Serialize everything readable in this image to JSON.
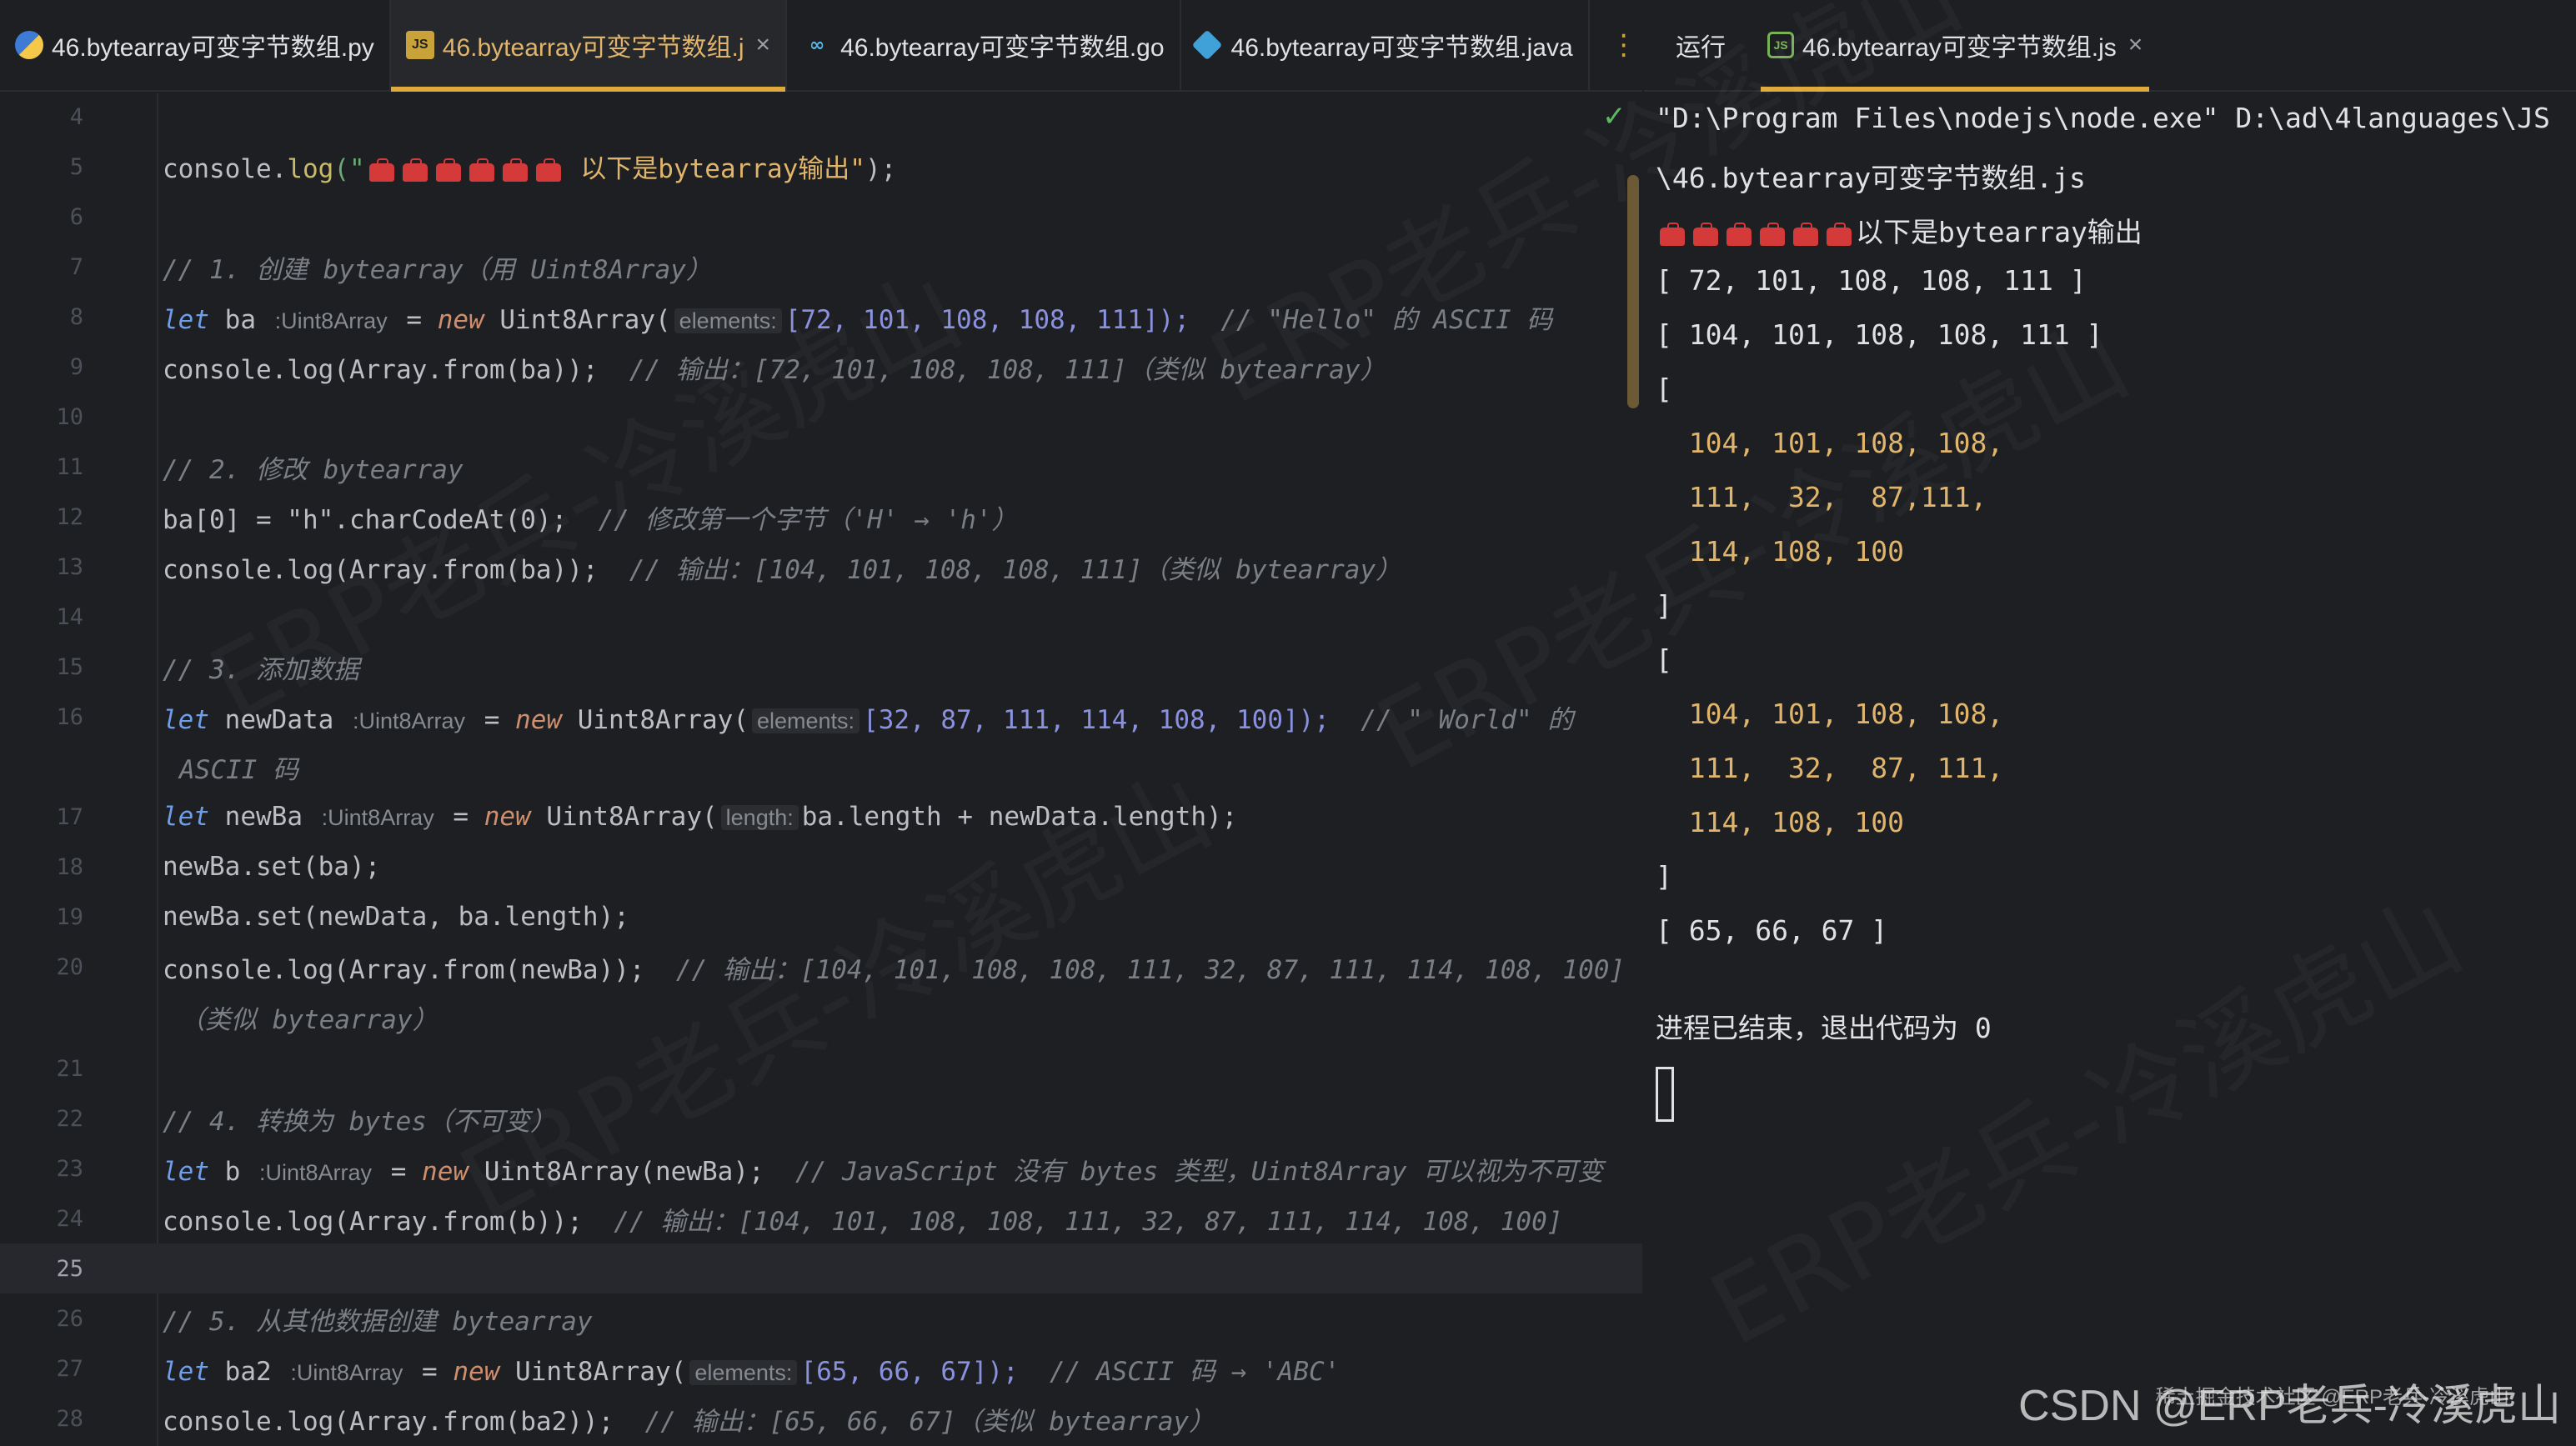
{
  "editor_tabs": [
    {
      "icon": "python-icon",
      "label": "46.bytearray可变字节数组.py",
      "active": false
    },
    {
      "icon": "javascript-icon",
      "label": "46.bytearray可变字节数组.j",
      "active": true,
      "close": "×"
    },
    {
      "icon": "go-icon",
      "label": "46.bytearray可变字节数组.go",
      "active": false
    },
    {
      "icon": "java-icon",
      "label": "46.bytearray可变字节数组.java",
      "active": false
    }
  ],
  "more_tabs": "⋮",
  "run_panel": {
    "label": "运行",
    "tab_label": "46.bytearray可变字节数组.js",
    "close": "×"
  },
  "line_numbers": [
    "4",
    "5",
    "6",
    "7",
    "8",
    "9",
    "10",
    "11",
    "12",
    "13",
    "14",
    "15",
    "16",
    "",
    "17",
    "18",
    "19",
    "20",
    "",
    "21",
    "22",
    "23",
    "24",
    "25",
    "26",
    "27",
    "28"
  ],
  "code": {
    "l5_pre": "console.",
    "l5_log": "log",
    "l5_str_open": "(\"",
    "l5_str_text": " 以下是bytearray输出\"",
    "l5_end": ");",
    "l7": "// 1. 创建 bytearray（用 Uint8Array）",
    "l8_let": "let",
    "l8_var": " ba ",
    "l8_type": ":Uint8Array",
    "l8_eq": " = ",
    "l8_new": "new",
    "l8_cls": " Uint8Array(",
    "l8_hint": "elements:",
    "l8_args": "[72, 101, 108, 108, 111]);",
    "l8_cmt": "  // \"Hello\" 的 ASCII 码",
    "l9_code": "console.log(Array.from(ba));",
    "l9_cmt": "  // 输出：[72, 101, 108, 108, 111]（类似 bytearray）",
    "l11": "// 2. 修改 bytearray",
    "l12_code": "ba[0] = \"h\".charCodeAt(0);",
    "l12_cmt": "  // 修改第一个字节（'H' → 'h'）",
    "l13_code": "console.log(Array.from(ba));",
    "l13_cmt": "  // 输出：[104, 101, 108, 108, 111]（类似 bytearray）",
    "l15": "// 3. 添加数据",
    "l16_let": "let",
    "l16_var": " newData ",
    "l16_type": ":Uint8Array",
    "l16_eq": " = ",
    "l16_new": "new",
    "l16_cls": " Uint8Array(",
    "l16_hint": "elements:",
    "l16_args": "[32, 87, 111, 114, 108, 100]);",
    "l16_cmt": "  // \" World\" 的",
    "l16_cont": "ASCII 码",
    "l17_let": "let",
    "l17_var": " newBa ",
    "l17_type": ":Uint8Array",
    "l17_eq": " = ",
    "l17_new": "new",
    "l17_cls": " Uint8Array(",
    "l17_hint": "length:",
    "l17_args": "ba.length + newData.length);",
    "l18": "newBa.set(ba);",
    "l19": "newBa.set(newData, ba.length);",
    "l20_code": "console.log(Array.from(newBa));",
    "l20_cmt": "  // 输出：[104, 101, 108, 108, 111, 32, 87, 111, 114, 108, 100]",
    "l20_cont": "（类似 bytearray）",
    "l22": "// 4. 转换为 bytes（不可变）",
    "l23_let": "let",
    "l23_var": " b ",
    "l23_type": ":Uint8Array",
    "l23_eq": " = ",
    "l23_new": "new",
    "l23_args": " Uint8Array(newBa);",
    "l23_cmt": "  // JavaScript 没有 bytes 类型，Uint8Array 可以视为不可变",
    "l24_code": "console.log(Array.from(b));",
    "l24_cmt": "  // 输出：[104, 101, 108, 108, 111, 32, 87, 111, 114, 108, 100]",
    "l26": "// 5. 从其他数据创建 bytearray",
    "l27_let": "let",
    "l27_var": " ba2 ",
    "l27_type": ":Uint8Array",
    "l27_eq": " = ",
    "l27_new": "new",
    "l27_cls": " Uint8Array(",
    "l27_hint": "elements:",
    "l27_args": "[65, 66, 67]);",
    "l27_cmt": "  // ASCII 码 → 'ABC'",
    "l28_code": "console.log(Array.from(ba2));",
    "l28_cmt": "  // 输出：[65, 66, 67]（类似 bytearray）"
  },
  "console": {
    "line1": "\"D:\\Program Files\\nodejs\\node.exe\" D:\\ad\\4languages\\JS",
    "line2": "\\46.bytearray可变字节数组.js",
    "line3_text": "以下是bytearray输出",
    "arr1": "[ 72, 101, 108, 108, 111 ]",
    "arr2": "[ 104, 101, 108, 108, 111 ]",
    "open1": "[",
    "b1r1": "  104, 101, 108, 108,",
    "b1r2": "  111,  32,  87,111,",
    "b1r3": "  114, 108, 100",
    "close1": "]",
    "open2": "[",
    "b2r1": "  104, 101, 108, 108,",
    "b2r2": "  111,  32,  87, 111,",
    "b2r3": "  114, 108, 100",
    "close2": "]",
    "arr3": "[ 65, 66, 67 ]",
    "exit": "进程已结束，退出代码为 0"
  },
  "watermark": {
    "text": "CSDN @ERP老兵-冷溪虎山",
    "small": "稀土掘金技术社区 @ERP老兵-冷溪虎山",
    "bg": "ERP老兵-冷溪虎山"
  }
}
